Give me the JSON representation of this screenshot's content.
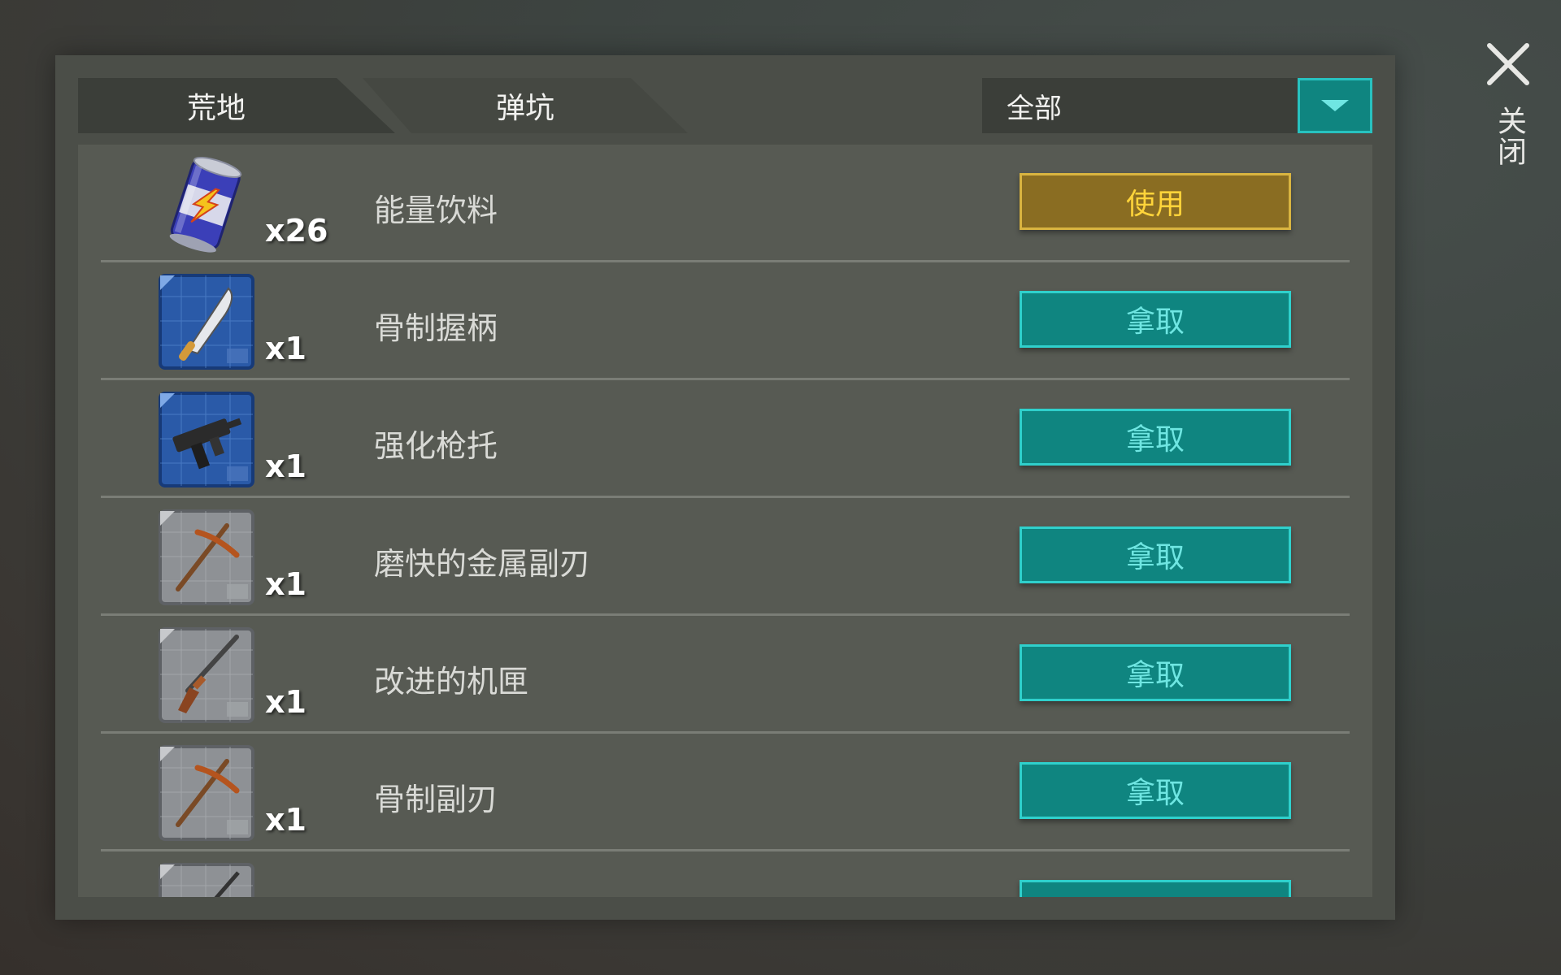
{
  "tabs": [
    {
      "label": "荒地",
      "active": true
    },
    {
      "label": "弹坑",
      "active": false
    }
  ],
  "filter": {
    "selected": "全部"
  },
  "close": {
    "label": "关闭"
  },
  "items": [
    {
      "name": "能量饮料",
      "qty": "x26",
      "action": "使用",
      "icon": "energy-drink-can-icon"
    },
    {
      "name": "骨制握柄",
      "qty": "x1",
      "action": "拿取",
      "icon": "machete-blueprint-icon"
    },
    {
      "name": "强化枪托",
      "qty": "x1",
      "action": "拿取",
      "icon": "smg-blueprint-icon"
    },
    {
      "name": "磨快的金属副刃",
      "qty": "x1",
      "action": "拿取",
      "icon": "pickaxe-blueprint-icon"
    },
    {
      "name": "改进的机匣",
      "qty": "x1",
      "action": "拿取",
      "icon": "shotgun-blueprint-icon"
    },
    {
      "name": "骨制副刃",
      "qty": "x1",
      "action": "拿取",
      "icon": "pickaxe-blueprint-icon"
    },
    {
      "name": "",
      "qty": "",
      "action": "",
      "icon": "blueprint-icon"
    }
  ],
  "colors": {
    "teal_button": "#0f8580",
    "teal_text": "#6fe6e2",
    "gold_button": "#8a6d22",
    "gold_text": "#ffd43a"
  }
}
